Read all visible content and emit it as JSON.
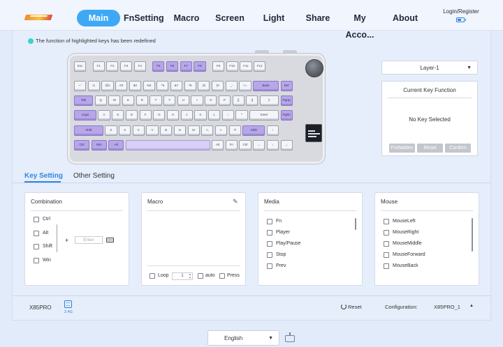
{
  "nav": {
    "items": [
      "Main",
      "FnSetting",
      "Macro",
      "Screen",
      "Light",
      "Share",
      "My Acco...",
      "About"
    ],
    "active": "Main",
    "login": "Login/Register"
  },
  "notice": "The function of highlighted keys has been redefined",
  "keyboard": {
    "rows": [
      [
        "Esc",
        "F1",
        "F2",
        "F3",
        "F4",
        "F5",
        "F6",
        "F7",
        "F8",
        "F9",
        "F10",
        "F11",
        "F12"
      ],
      [
        "~`",
        "!1",
        "@2",
        "#3",
        "$4",
        "%5",
        "^6",
        "&7",
        "*8",
        "(9",
        ")0",
        "_-",
        "+=",
        "Back",
        "Del"
      ],
      [
        "Tab",
        "Q",
        "W",
        "E",
        "R",
        "T",
        "Y",
        "U",
        "I",
        "O",
        "P",
        "{[",
        "}]",
        "|\\",
        "PgUp"
      ],
      [
        "Caps",
        "A",
        "S",
        "D",
        "F",
        "G",
        "H",
        "J",
        "K",
        "L",
        ":;",
        "\"'",
        "Enter",
        "PgDn"
      ],
      [
        "Shift",
        "Z",
        "X",
        "C",
        "V",
        "B",
        "N",
        "M",
        "<,",
        ">.",
        "?/",
        "Shift",
        "↑"
      ],
      [
        "Ctrl",
        "Win",
        "Alt",
        "",
        "Alt",
        "Fn",
        "Ctrl",
        "←",
        "↓",
        "→"
      ]
    ]
  },
  "layer": {
    "selected": "Layer-1"
  },
  "current_key": {
    "title": "Current Key Function",
    "empty": "No Key Selected",
    "buttons": [
      "Forbidden",
      "Reset",
      "Confirm"
    ]
  },
  "tabs": [
    "Key Setting",
    "Other Setting"
  ],
  "combination": {
    "title": "Combination",
    "modifiers": [
      "Ctrl",
      "Alt",
      "Shift",
      "Win"
    ],
    "plus": "+",
    "input_placeholder": "Enter"
  },
  "macro": {
    "title": "Macro",
    "loop_label": "Loop",
    "loop_value": "1",
    "auto_label": "auto",
    "press_label": "Press"
  },
  "media": {
    "title": "Media",
    "items": [
      "Fn",
      "Player",
      "Play/Pause",
      "Stop",
      "Prev"
    ]
  },
  "mouse": {
    "title": "Mouse",
    "items": [
      "MouseLeft",
      "MouseRight",
      "MouseMiddle",
      "MouseForward",
      "MouseBack"
    ]
  },
  "status": {
    "device": "X85PRO",
    "band": "2.4G",
    "reset": "Reset",
    "configuration_label": "Configuration:",
    "configuration_value": "X85PRO_1"
  },
  "footer": {
    "language": "English"
  },
  "colors": {
    "accent": "#3fa8f5",
    "link": "#2f86e0",
    "highlight_key": "#b7a6e8",
    "light_key": "#d8d0f5",
    "notice_dot": "#3fd3c6"
  }
}
